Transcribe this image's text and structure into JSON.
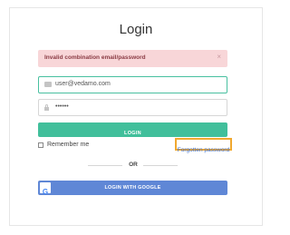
{
  "page": {
    "title": "Login"
  },
  "alert": {
    "message": "Invalid combination email/password",
    "close_symbol": "×"
  },
  "form": {
    "email": {
      "value": "user@vedamo.com",
      "icon": "envelope-icon"
    },
    "password": {
      "value": "••••••",
      "icon": "lock-icon"
    },
    "login_button_label": "LOGIN",
    "remember_me_label": "Remember me",
    "remember_me_checked": false,
    "forgot_password_label": "Forgotten password"
  },
  "divider": {
    "label": "OR"
  },
  "google": {
    "button_label": "LOGIN WITH GOOGLE",
    "logo_letter": "G"
  },
  "colors": {
    "alert_bg": "#f8d6d8",
    "alert_text": "#8a3b44",
    "accent_green": "#41bf9b",
    "google_blue": "#5f87d6",
    "link_blue": "#3d6fd1",
    "highlight_orange": "#f0a830"
  }
}
